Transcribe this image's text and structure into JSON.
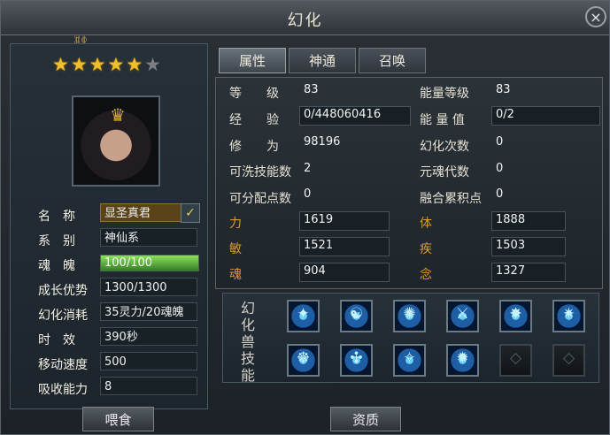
{
  "window": {
    "title": "幻化"
  },
  "stars": {
    "filled": 5,
    "total": 6
  },
  "character": {
    "name_label": "名　称",
    "name_value": "显圣真君",
    "series_label": "系　别",
    "series_value": "神仙系",
    "soul_label": "魂　魄",
    "soul_value": "100/100",
    "soul_fraction": 1.0,
    "growth_label": "成长优势",
    "growth_value": "1300/1300",
    "cost_label": "幻化消耗",
    "cost_value": "35灵力/20魂魄",
    "time_label": "时　效",
    "time_value": "390秒",
    "speed_label": "移动速度",
    "speed_value": "500",
    "absorb_label": "吸收能力",
    "absorb_value": "8"
  },
  "buttons": {
    "feed": "喂食",
    "quality": "资质"
  },
  "tabs": [
    {
      "label": "属性",
      "active": true
    },
    {
      "label": "神通",
      "active": false
    },
    {
      "label": "召唤",
      "active": false
    }
  ],
  "attributes": {
    "level_label": "等　　级",
    "level_value": "83",
    "energy_level_label": "能量等级",
    "energy_level_value": "83",
    "exp_label": "经　　验",
    "exp_value": "0/448060416",
    "energy_value_label": "能 量 值",
    "energy_value_value": "0/2",
    "cultivation_label": "修　　为",
    "cultivation_value": "98196",
    "morph_count_label": "幻化次数",
    "morph_count_value": "0",
    "refresh_skill_label": "可洗技能数",
    "refresh_skill_value": "2",
    "soul_gen_label": "元魂代数",
    "soul_gen_value": "0",
    "points_label": "可分配点数",
    "points_value": "0",
    "fusion_label": "融合累积点",
    "fusion_value": "0",
    "power_label": "力",
    "power_value": "1619",
    "body_label": "体",
    "body_value": "1888",
    "agility_label": "敏",
    "agility_value": "1521",
    "speed_label": "疾",
    "speed_value": "1503",
    "soul_label": "魂",
    "soul_value": "904",
    "mind_label": "念",
    "mind_value": "1327"
  },
  "skills": {
    "title": "幻化兽技能",
    "icons": [
      "skill-icon-1",
      "skill-icon-2",
      "skill-icon-3",
      "skill-icon-4",
      "skill-icon-5",
      "skill-icon-6",
      "skill-icon-7",
      "skill-icon-8",
      "skill-icon-9",
      "skill-icon-10",
      "empty-skill-icon",
      "empty-skill-icon"
    ]
  }
}
